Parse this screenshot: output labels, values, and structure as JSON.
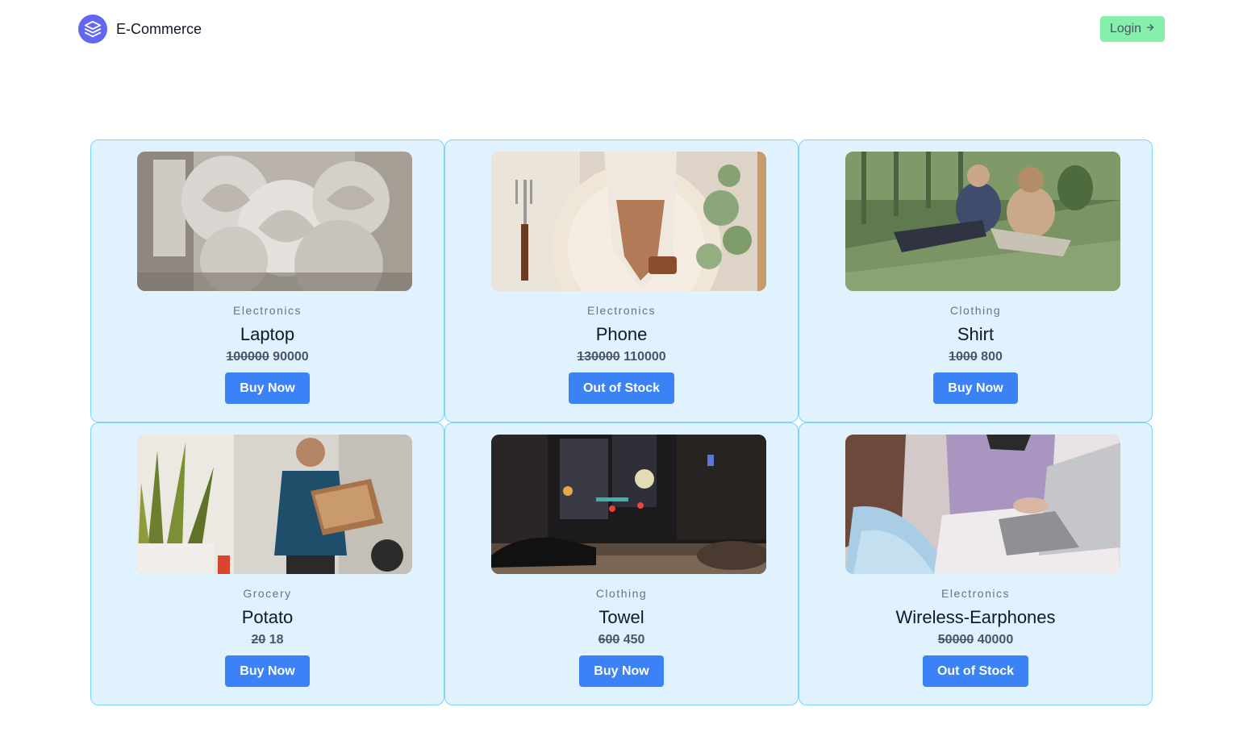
{
  "header": {
    "brand_name": "E-Commerce",
    "brand_icon": "layers-icon",
    "login_label": "Login",
    "login_icon": "arrow-right-icon"
  },
  "colors": {
    "brand": "#6366f1",
    "login_bg": "#86efac",
    "card_bg": "#e0f2fe",
    "card_border": "#7dd3fc",
    "button": "#3b82f6"
  },
  "products": [
    {
      "category": "Electronics",
      "name": "Laptop",
      "original_price": "100000",
      "price": "90000",
      "button_label": "Buy Now"
    },
    {
      "category": "Electronics",
      "name": "Phone",
      "original_price": "130000",
      "price": "110000",
      "button_label": "Out of Stock"
    },
    {
      "category": "Clothing",
      "name": "Shirt",
      "original_price": "1000",
      "price": "800",
      "button_label": "Buy Now"
    },
    {
      "category": "Grocery",
      "name": "Potato",
      "original_price": "20",
      "price": "18",
      "button_label": "Buy Now"
    },
    {
      "category": "Clothing",
      "name": "Towel",
      "original_price": "600",
      "price": "450",
      "button_label": "Buy Now"
    },
    {
      "category": "Electronics",
      "name": "Wireless-Earphones",
      "original_price": "50000",
      "price": "40000",
      "button_label": "Out of Stock"
    }
  ]
}
